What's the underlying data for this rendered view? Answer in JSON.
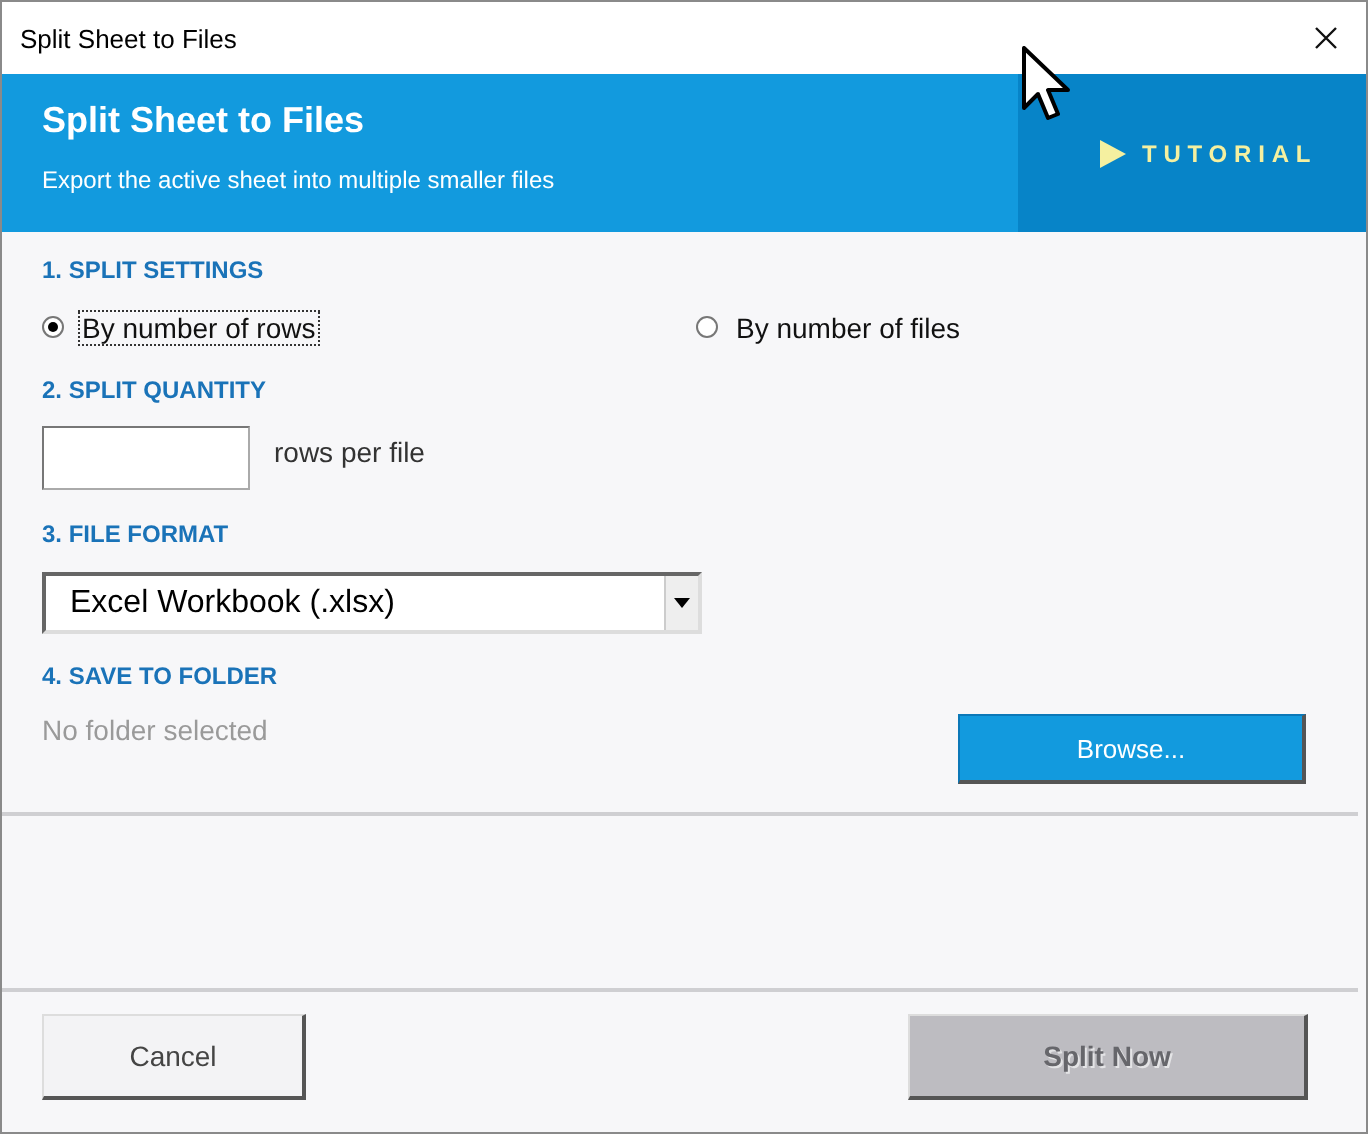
{
  "window": {
    "title": "Split Sheet to Files"
  },
  "header": {
    "title": "Split Sheet to Files",
    "subtitle": "Export the active sheet into multiple smaller files",
    "tutorial": "TUTORIAL"
  },
  "sections": [
    {
      "heading": "1. SPLIT SETTINGS",
      "kind": "radios",
      "options": [
        {
          "label": "By number of rows",
          "selected": true
        },
        {
          "label": "By number of files",
          "selected": false
        }
      ]
    },
    {
      "heading": "2. SPLIT QUANTITY",
      "kind": "quantity",
      "unit": "rows per file"
    },
    {
      "heading": "3. FILE FORMAT",
      "kind": "select",
      "value": "Excel Workbook (.xlsx)"
    },
    {
      "heading": "4. SAVE TO FOLDER",
      "kind": "folder",
      "path": "No folder selected",
      "button": "Browse..."
    }
  ],
  "buttons": [
    {
      "label": "Cancel",
      "disabled": false
    },
    {
      "label": "Split Now",
      "disabled": true
    }
  ]
}
